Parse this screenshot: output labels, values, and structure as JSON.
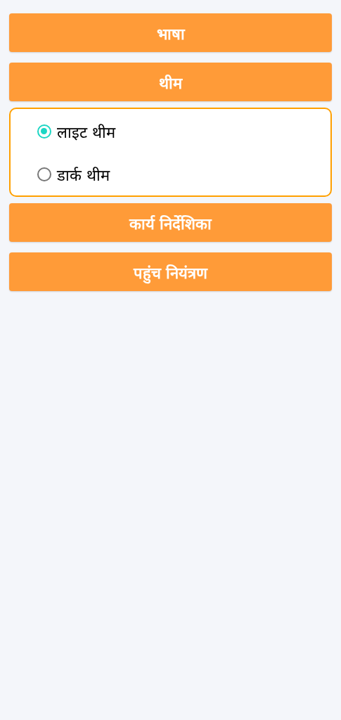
{
  "sections": [
    {
      "kind": "button",
      "label": "भाषा"
    },
    {
      "kind": "button",
      "label": "थीम"
    },
    {
      "kind": "radio_group",
      "options": [
        {
          "label": "लाइट थीम",
          "selected": true
        },
        {
          "label": "डार्क थीम",
          "selected": false
        }
      ]
    },
    {
      "kind": "button",
      "label": "कार्य निर्देशिका"
    },
    {
      "kind": "button",
      "label": "पहुंच नियंत्रण"
    }
  ]
}
